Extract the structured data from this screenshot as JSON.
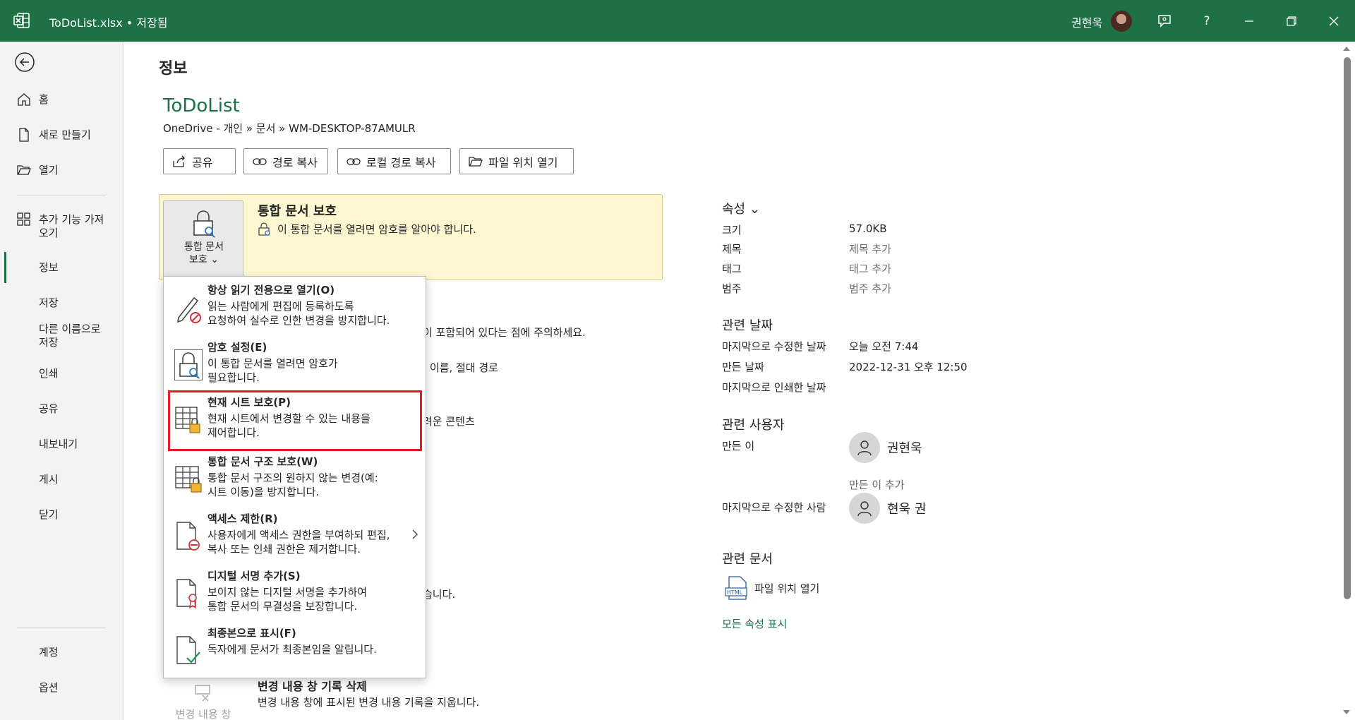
{
  "titlebar": {
    "file_name": "ToDoList.xlsx",
    "separator": "•",
    "save_status": "저장됨",
    "user_name": "권현욱"
  },
  "nav": {
    "home": "홈",
    "new": "새로 만들기",
    "open": "열기",
    "addins_line1": "추가 기능 가져",
    "addins_line2": "오기",
    "info": "정보",
    "save": "저장",
    "saveas_line1": "다른 이름으로",
    "saveas_line2": "저장",
    "print": "인쇄",
    "share": "공유",
    "export": "내보내기",
    "publish": "게시",
    "close": "닫기",
    "account": "계정",
    "options": "옵션"
  },
  "main": {
    "page_title": "정보",
    "doc_name": "ToDoList",
    "doc_path": "OneDrive - 개인 » 문서 » WM-DESKTOP-87AMULR",
    "buttons": {
      "share": "공유",
      "copy_path": "경로 복사",
      "copy_local_path": "로컬 경로 복사",
      "open_location": "파일 위치 열기"
    },
    "protect": {
      "button_line1": "통합 문서",
      "button_line2": "보호 ⌄",
      "title": "통합 문서 보호",
      "description": "이 통합 문서를 열려면 암호를 알아야 합니다."
    },
    "behind": {
      "line1": "이 포함되어 있다는 점에 주의하세요.",
      "line2": "| 이름, 절대 경로",
      "line3": "려운 콘텐츠",
      "line4": "습니다.",
      "line5": "변경 내용 창 기록 삭제",
      "line6": "변경 내용 창에 표시된 변경 내용 기록을 지웁니다.",
      "icon_label": "변경 내용 창"
    }
  },
  "dropdown": {
    "items": [
      {
        "title": "항상 읽기 전용으로 열기(O)",
        "desc1": "읽는 사람에게 편집에 등록하도록",
        "desc2": "요청하여 실수로 인한 변경을 방지합니다.",
        "icon": "pencil-no-icon"
      },
      {
        "title": "암호 설정(E)",
        "desc1": "이 통합 문서를 열려면 암호가",
        "desc2": "필요합니다.",
        "icon": "lock-search-icon"
      },
      {
        "title": "현재 시트 보호(P)",
        "desc1": "현재 시트에서 변경할 수 있는 내용을",
        "desc2": "제어합니다.",
        "icon": "sheet-lock-icon"
      },
      {
        "title": "통합 문서 구조 보호(W)",
        "desc1": "통합 문서 구조의 원하지 않는 변경(예:",
        "desc2": "시트 이동)을 방지합니다.",
        "icon": "workbook-lock-icon"
      },
      {
        "title": "액세스 제한(R)",
        "desc1": "사용자에게 액세스 권한을 부여하되 편집,",
        "desc2": "복사 또는 인쇄 권한은 제거합니다.",
        "icon": "doc-restrict-icon"
      },
      {
        "title": "디지털 서명 추가(S)",
        "desc1": "보이지 않는 디지털 서명을 추가하여",
        "desc2": "통합 문서의 무결성을 보장합니다.",
        "icon": "doc-ribbon-icon"
      },
      {
        "title": "최종본으로 표시(F)",
        "desc1": "독자에게 문서가 최종본임을 알립니다.",
        "desc2": "",
        "icon": "doc-check-icon"
      }
    ]
  },
  "properties": {
    "heading": "속성 ⌄",
    "size_label": "크기",
    "size_value": "57.0KB",
    "title_label": "제목",
    "title_value": "제목 추가",
    "tags_label": "태그",
    "tags_value": "태그 추가",
    "category_label": "범주",
    "category_value": "범주 추가",
    "dates_heading": "관련 날짜",
    "modified_label": "마지막으로 수정한 날짜",
    "modified_value": "오늘 오전 7:44",
    "created_label": "만든 날짜",
    "created_value": "2022-12-31 오후 12:50",
    "printed_label": "마지막으로 인쇄한 날짜",
    "people_heading": "관련 사용자",
    "author_label": "만든 이",
    "author_name": "권현욱",
    "add_author": "만든 이 추가",
    "last_modified_by_label": "마지막으로 수정한 사람",
    "last_modified_by_name": "현욱 권",
    "docs_heading": "관련 문서",
    "open_location": "파일 위치 열기",
    "show_all": "모든 속성 표시"
  },
  "colors": {
    "brand": "#1e7145",
    "protect_bg": "#fef7d1",
    "highlight": "#e21c24"
  }
}
